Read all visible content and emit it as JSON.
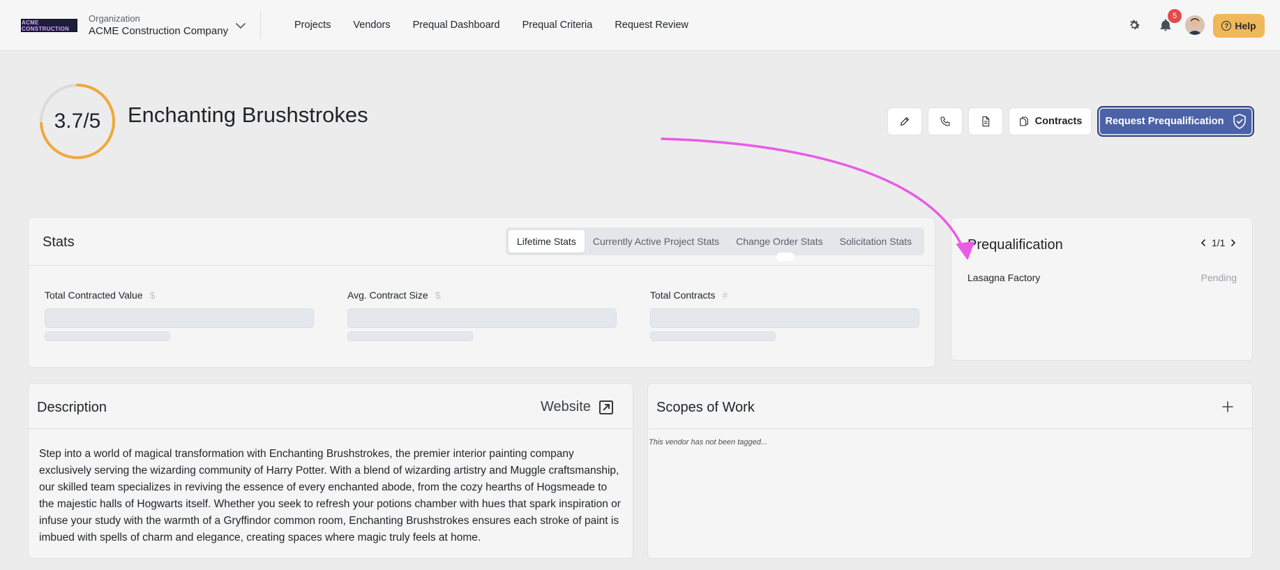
{
  "nav": {
    "logo_text": "ACME CONSTRUCTION",
    "org_label": "Organization",
    "org_name": "ACME Construction Company",
    "links": [
      "Projects",
      "Vendors",
      "Prequal Dashboard",
      "Prequal Criteria",
      "Request Review"
    ],
    "notification_count": "5",
    "help_label": "Help"
  },
  "vendor": {
    "score": "3.7/5",
    "score_fraction": 0.74,
    "name": "Enchanting Brushstrokes"
  },
  "actions": {
    "contracts_label": "Contracts",
    "request_prequal_label": "Request Prequalification"
  },
  "stats": {
    "title": "Stats",
    "tabs": [
      "Lifetime Stats",
      "Currently Active Project Stats",
      "Change Order Stats",
      "Solicitation Stats"
    ],
    "active_tab": "Lifetime Stats",
    "items": [
      {
        "label": "Total Contracted Value",
        "unit": "$"
      },
      {
        "label": "Avg. Contract Size",
        "unit": "$"
      },
      {
        "label": "Total Contracts",
        "unit": "#"
      }
    ]
  },
  "prequal": {
    "title": "Prequalification",
    "pager": "1/1",
    "row_name": "Lasagna Factory",
    "row_status": "Pending"
  },
  "description": {
    "title": "Description",
    "website_label": "Website",
    "text": "Step into a world of magical transformation with Enchanting Brushstrokes, the premier interior painting company exclusively serving the wizarding community of Harry Potter. With a blend of wizarding artistry and Muggle craftsmanship, our skilled team specializes in reviving the essence of every enchanted abode, from the cozy hearths of Hogsmeade to the majestic halls of Hogwarts itself. Whether you seek to refresh your potions chamber with hues that spark inspiration or infuse your study with the warmth of a Gryffindor common room, Enchanting Brushstrokes ensures each stroke of paint is imbued with spells of charm and elegance, creating spaces where magic truly feels at home."
  },
  "scopes": {
    "title": "Scopes of Work",
    "empty_text": "This vendor has not been tagged..."
  },
  "colors": {
    "score_ring": "#f0a83c",
    "primary_button": "#4b62a6",
    "help_button": "#efb85a",
    "annotation_arrow": "#e85ce6"
  }
}
